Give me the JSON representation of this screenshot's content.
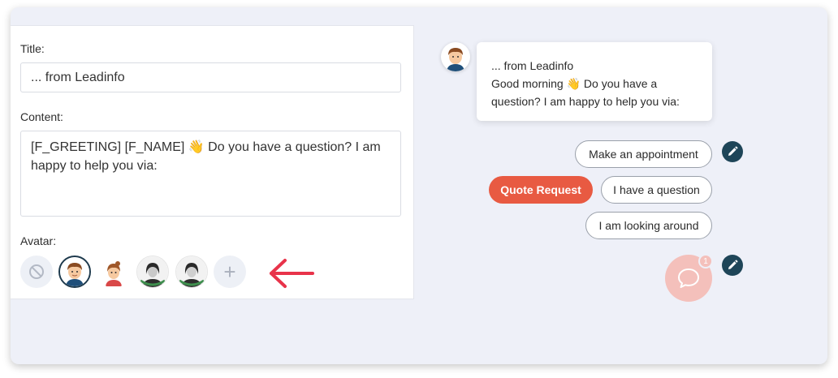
{
  "form": {
    "title_label": "Title:",
    "title_value": "... from Leadinfo",
    "content_label": "Content:",
    "content_value": "[F_GREETING] [F_NAME] 👋 Do you have a question? I am happy to help you via:",
    "avatar_label": "Avatar:",
    "avatars": [
      {
        "name": "no-avatar-icon"
      },
      {
        "name": "avatar-man",
        "selected": true
      },
      {
        "name": "avatar-woman"
      },
      {
        "name": "avatar-photo-1"
      },
      {
        "name": "avatar-photo-2"
      },
      {
        "name": "add-avatar-icon",
        "label": "+"
      }
    ]
  },
  "preview": {
    "title": "... from Leadinfo",
    "message_line1": "Good morning 👋 Do you have a",
    "message_line2": "question? I am happy to help you via:",
    "buttons": {
      "appointment": "Make an appointment",
      "quote": "Quote Request",
      "question": "I have a question",
      "looking": "I am looking around"
    },
    "badge_count": "1"
  },
  "colors": {
    "accent": "#e85a42",
    "edit": "#1e4558",
    "arrow": "#e8334a",
    "launcher": "#f4c0bb"
  }
}
